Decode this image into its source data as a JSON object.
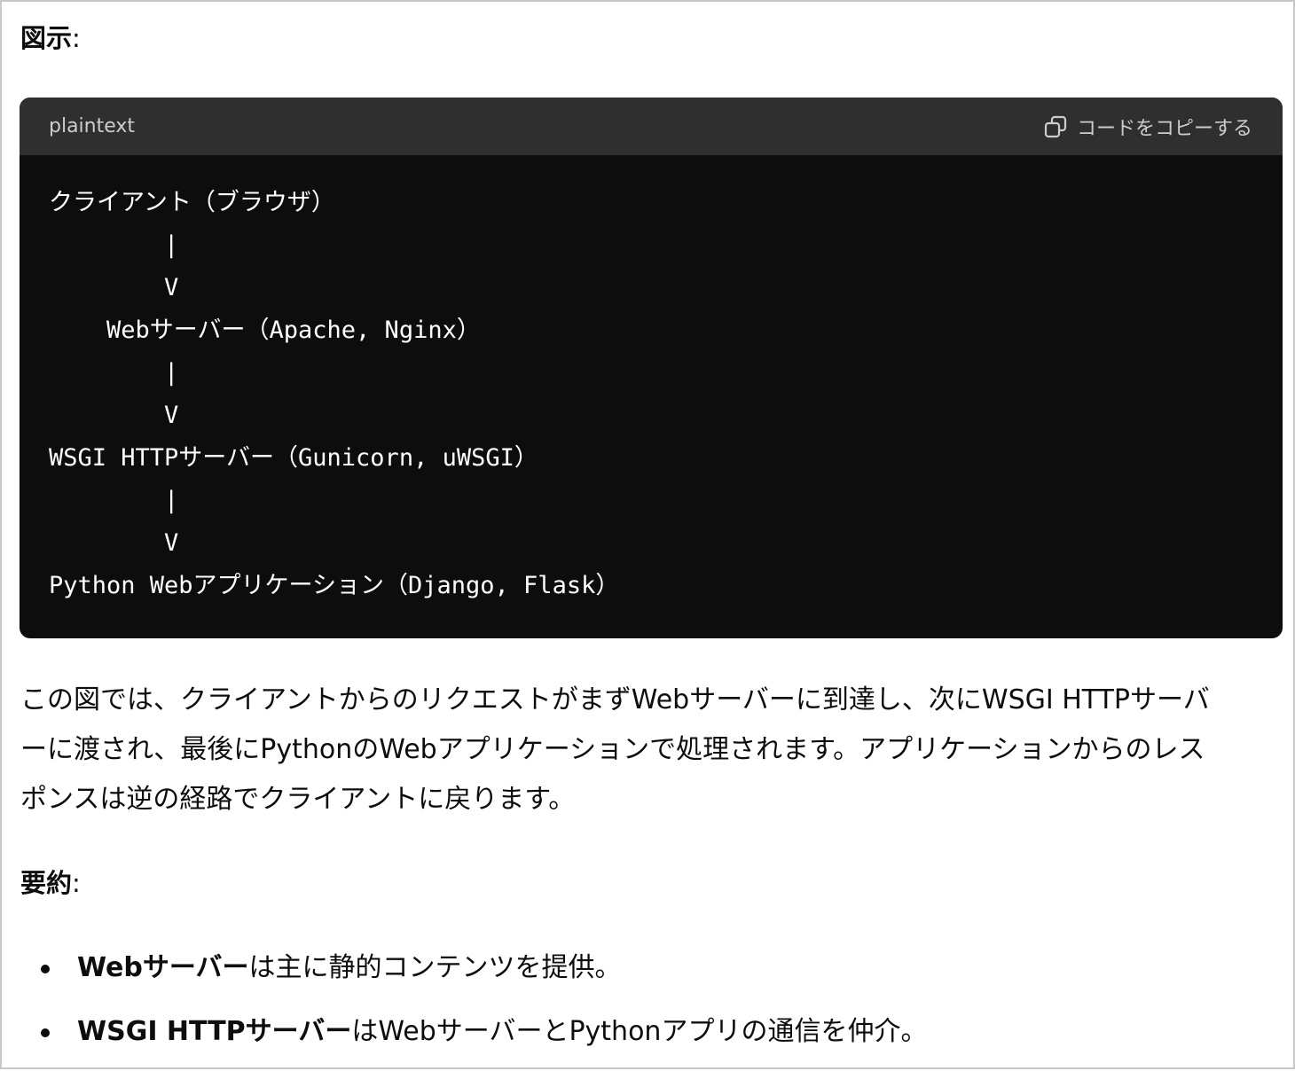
{
  "section1": {
    "title": "図示",
    "colon": ":"
  },
  "code_block": {
    "language": "plaintext",
    "copy_label": "コードをコピーする",
    "lines": [
      "クライアント（ブラウザ）",
      "        |",
      "        V",
      "    Webサーバー（Apache, Nginx）",
      "        |",
      "        V",
      "WSGI HTTPサーバー（Gunicorn, uWSGI）",
      "        |",
      "        V",
      "Python Webアプリケーション（Django, Flask）"
    ]
  },
  "paragraph": {
    "lines": [
      "この図では、クライアントからのリクエストがまずWebサーバーに到達し、次にWSGI HTTPサーバ",
      "ーに渡され、最後にPythonのWebアプリケーションで処理されます。アプリケーションからのレス",
      "ポンスは逆の経路でクライアントに戻ります。"
    ]
  },
  "section2": {
    "title": "要約",
    "colon": ":"
  },
  "bullets": [
    {
      "bold": "Webサーバー",
      "rest": "は主に静的コンテンツを提供。"
    },
    {
      "bold": "WSGI HTTPサーバー",
      "rest": "はWebサーバーとPythonアプリの通信を仲介。"
    }
  ]
}
